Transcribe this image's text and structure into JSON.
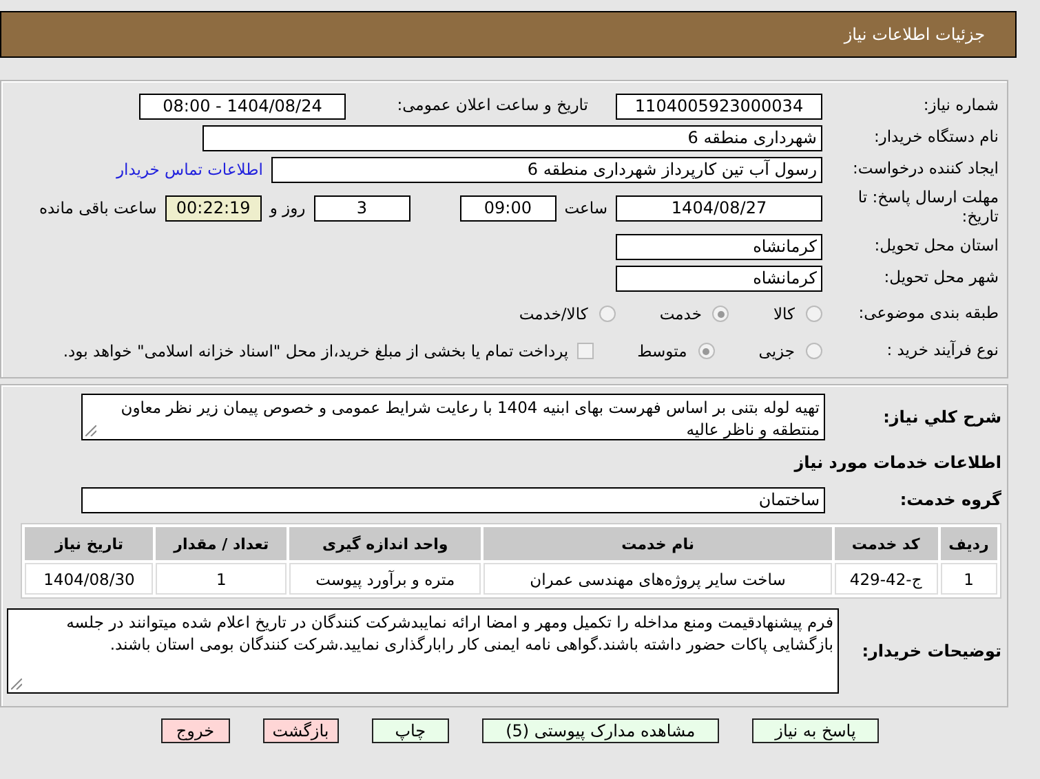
{
  "header": {
    "title": "جزئیات اطلاعات نیاز"
  },
  "need_number": {
    "label": "شماره نیاز:",
    "value": "1104005923000034"
  },
  "announce": {
    "label": "تاریخ و ساعت اعلان عمومی:",
    "value": "1404/08/24 - 08:00"
  },
  "buyer": {
    "label": "نام دستگاه خریدار:",
    "value": "شهرداری منطقه 6"
  },
  "creator": {
    "label": "ایجاد کننده درخواست:",
    "value": "رسول آب تین کارپرداز شهرداری منطقه 6",
    "link": "اطلاعات تماس خریدار"
  },
  "deadline": {
    "label": "مهلت ارسال پاسخ: تا تاریخ:",
    "date": "1404/08/27",
    "time_label": "ساعت",
    "time": "09:00",
    "days": "3",
    "days_label": "روز و",
    "remaining": "00:22:19",
    "remaining_label": "ساعت باقی مانده"
  },
  "province": {
    "label": "استان محل تحویل:",
    "value": "کرمانشاه"
  },
  "city": {
    "label": "شهر محل تحویل:",
    "value": "کرمانشاه"
  },
  "category": {
    "label": "طبقه بندی موضوعی:",
    "options": [
      {
        "label": "کالا",
        "selected": false
      },
      {
        "label": "خدمت",
        "selected": true
      },
      {
        "label": "کالا/خدمت",
        "selected": false
      }
    ]
  },
  "process": {
    "label": "نوع فرآیند خرید :",
    "options": [
      {
        "label": "جزیی",
        "selected": false
      },
      {
        "label": "متوسط",
        "selected": true
      }
    ],
    "payment": {
      "checked": false,
      "label": "پرداخت تمام یا بخشی از مبلغ خرید،از محل \"اسناد خزانه اسلامی\" خواهد بود."
    }
  },
  "description": {
    "label": "شرح کلي نیاز:",
    "value": "تهیه لوله بتنی بر اساس فهرست بهای ابنیه 1404 با رعایت شرایط عمومی و خصوص پیمان زیر نظر معاون منتطقه و ناظر عالیه"
  },
  "services_heading": "اطلاعات خدمات مورد نیاز",
  "service_group": {
    "label": "گروه خدمت:",
    "value": "ساختمان"
  },
  "table": {
    "columns": [
      "ردیف",
      "کد خدمت",
      "نام خدمت",
      "واحد اندازه گیری",
      "تعداد / مقدار",
      "تاریخ نیاز"
    ],
    "rows": [
      [
        "1",
        "ج-42-429",
        "ساخت سایر پروژه‌های مهندسی عمران",
        "متره و برآورد پیوست",
        "1",
        "1404/08/30"
      ]
    ]
  },
  "notes": {
    "label": "توضیحات خریدار:",
    "value": "فرم پیشنهادقیمت ومنع مداخله را تکمیل ومهر و امضا ارائه نمایبدشرکت کنندگان در تاریخ اعلام شده میتوانند در جلسه بازگشایی پاکات حضور داشته باشند.گواهی نامه ایمنی کار  رابارگذاری نمایید.شرکت کنندگان بومی استان باشند."
  },
  "buttons": [
    {
      "label": "پاسخ به نیاز",
      "kind": "action"
    },
    {
      "label": "مشاهده مدارک پیوستی (5)",
      "kind": "action"
    },
    {
      "label": "چاپ",
      "kind": "action"
    },
    {
      "label": "بازگشت",
      "kind": "exit"
    },
    {
      "label": "خروج",
      "kind": "exit"
    }
  ]
}
